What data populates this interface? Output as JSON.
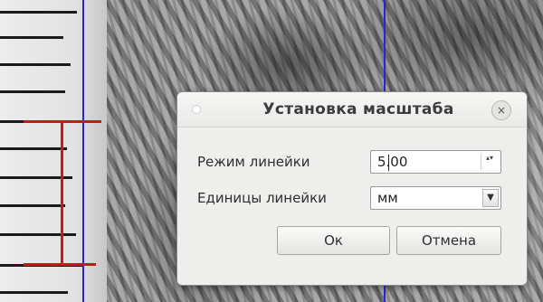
{
  "dialog": {
    "title": "Установка масштаба",
    "close_glyph": "×",
    "mode_label": "Режим линейки",
    "mode_value": "5.00",
    "units_label": "Единицы линейки",
    "units_value": "мм",
    "ok_label": "Ок",
    "cancel_label": "Отмена"
  },
  "icons": {
    "spin_arrows": "▴▾",
    "dropdown": "▼"
  },
  "colors": {
    "guide_line": "#1f2bd0",
    "measure_line": "#d21414"
  }
}
